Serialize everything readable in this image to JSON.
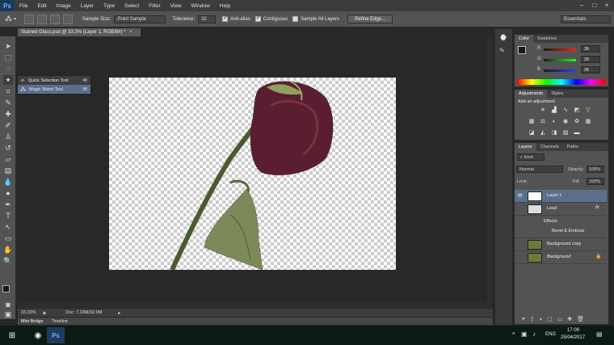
{
  "menubar": {
    "logo": "Ps",
    "items": [
      "File",
      "Edit",
      "Image",
      "Layer",
      "Type",
      "Select",
      "Filter",
      "View",
      "Window",
      "Help"
    ]
  },
  "options": {
    "sample_size_label": "Sample Size:",
    "sample_size_value": "Point Sample",
    "tolerance_label": "Tolerance:",
    "tolerance_value": "32",
    "anti_alias": "Anti-alias",
    "contiguous": "Contiguous",
    "sample_all_layers": "Sample All Layers",
    "refine_edge": "Refine Edge...",
    "workspace": "Essentials"
  },
  "document": {
    "tab_title": "Stained Glass.psd @ 33.3% (Layer 1, RGB/8#) *",
    "zoom": "33.33%",
    "doc_info": "Doc: 7.03M/32.0M"
  },
  "flyout": {
    "items": [
      {
        "label": "Quick Selection Tool",
        "key": "W"
      },
      {
        "label": "Magic Wand Tool",
        "key": "W"
      }
    ]
  },
  "bottom_tabs": [
    "Mini Bridge",
    "Timeline"
  ],
  "color_panel": {
    "tabs": [
      "Color",
      "Swatches"
    ],
    "channels": [
      {
        "label": "R",
        "value": "26",
        "color": "#e04040"
      },
      {
        "label": "G",
        "value": "26",
        "color": "#40c040"
      },
      {
        "label": "B",
        "value": "26",
        "color": "#4060e0"
      }
    ]
  },
  "adjustments_panel": {
    "tabs": [
      "Adjustments",
      "Styles"
    ],
    "heading": "Add an adjustment"
  },
  "layers_panel": {
    "tabs": [
      "Layers",
      "Channels",
      "Paths"
    ],
    "kind": "Kind",
    "blend_mode": "Normal",
    "opacity_label": "Opacity:",
    "opacity_value": "100%",
    "lock_label": "Lock:",
    "fill_label": "Fill:",
    "fill_value": "100%",
    "layers": [
      {
        "name": "Layer 1",
        "selected": true
      },
      {
        "name": "Lead",
        "fx": "fx"
      },
      {
        "name": "Effects",
        "sub": true
      },
      {
        "name": "Bevel & Emboss",
        "sub": true
      },
      {
        "name": "Background copy"
      },
      {
        "name": "Background",
        "italic": true
      }
    ]
  },
  "taskbar": {
    "language": "ENG",
    "time": "17:09",
    "date": "25/04/2017"
  }
}
